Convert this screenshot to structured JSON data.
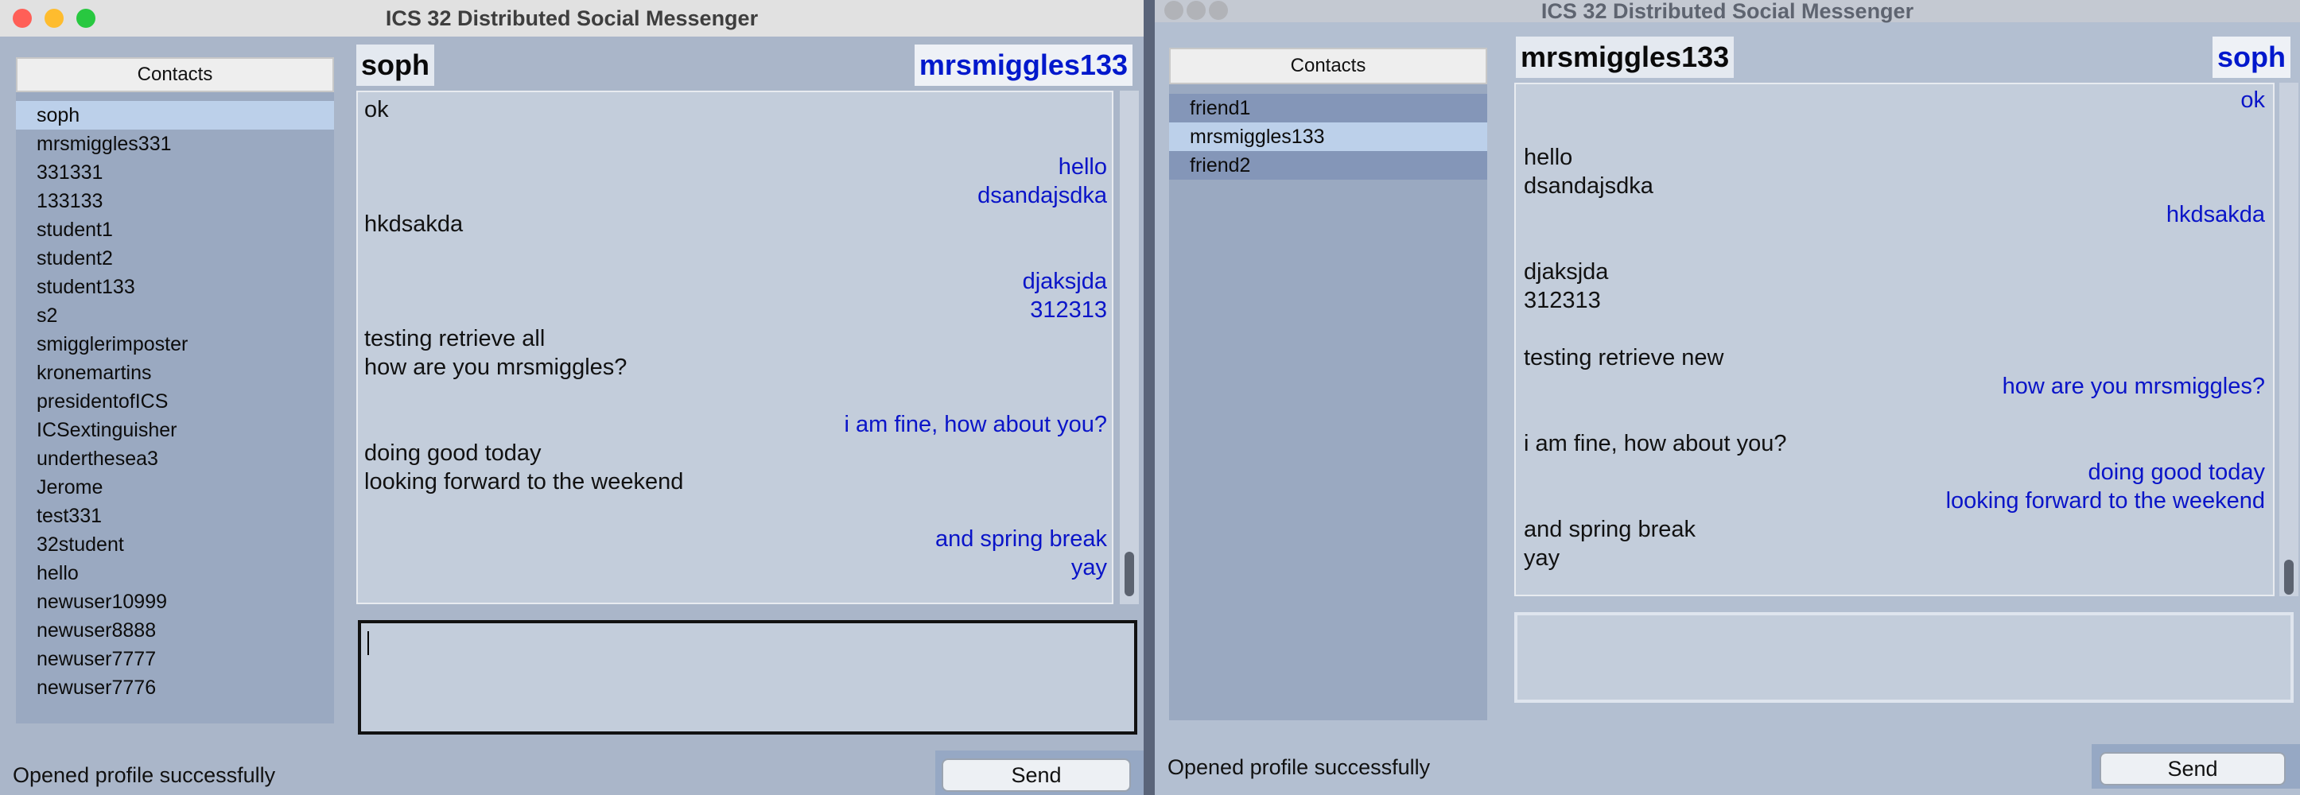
{
  "left_window": {
    "title": "ICS 32 Distributed Social Messenger",
    "contacts_header": "Contacts",
    "contacts": [
      {
        "name": "soph",
        "selected": true
      },
      {
        "name": "mrsmiggles331",
        "selected": false
      },
      {
        "name": "331331",
        "selected": false
      },
      {
        "name": "133133",
        "selected": false
      },
      {
        "name": "student1",
        "selected": false
      },
      {
        "name": "student2",
        "selected": false
      },
      {
        "name": "student133",
        "selected": false
      },
      {
        "name": "s2",
        "selected": false
      },
      {
        "name": "smigglerimposter",
        "selected": false
      },
      {
        "name": "kronemartins",
        "selected": false
      },
      {
        "name": "presidentofICS",
        "selected": false
      },
      {
        "name": "ICSextinguisher",
        "selected": false
      },
      {
        "name": "underthesea3",
        "selected": false
      },
      {
        "name": "Jerome",
        "selected": false
      },
      {
        "name": "test331",
        "selected": false
      },
      {
        "name": "32student",
        "selected": false
      },
      {
        "name": "hello",
        "selected": false
      },
      {
        "name": "newuser10999",
        "selected": false
      },
      {
        "name": "newuser8888",
        "selected": false
      },
      {
        "name": "newuser7777",
        "selected": false
      },
      {
        "name": "newuser7776",
        "selected": false
      }
    ],
    "recipient": "soph",
    "current_user": "mrsmiggles133",
    "messages": [
      {
        "text": "ok",
        "from": "mine"
      },
      {
        "text": "",
        "from": "blank"
      },
      {
        "text": "hello",
        "from": "theirs"
      },
      {
        "text": "dsandajsdka",
        "from": "theirs"
      },
      {
        "text": "hkdsakda",
        "from": "mine"
      },
      {
        "text": "",
        "from": "blank"
      },
      {
        "text": "djaksjda",
        "from": "theirs"
      },
      {
        "text": "312313",
        "from": "theirs"
      },
      {
        "text": "testing retrieve all",
        "from": "mine"
      },
      {
        "text": "how are you mrsmiggles?",
        "from": "mine"
      },
      {
        "text": "",
        "from": "blank"
      },
      {
        "text": "i am fine, how about you?",
        "from": "theirs"
      },
      {
        "text": "doing good today",
        "from": "mine"
      },
      {
        "text": "looking forward to the weekend",
        "from": "mine"
      },
      {
        "text": "",
        "from": "blank"
      },
      {
        "text": "and spring break",
        "from": "theirs"
      },
      {
        "text": "yay",
        "from": "theirs"
      }
    ],
    "status": "Opened profile successfully",
    "send_label": "Send"
  },
  "right_window": {
    "title": "ICS 32 Distributed Social Messenger",
    "contacts_header": "Contacts",
    "contacts": [
      {
        "name": "friend1",
        "selected": false
      },
      {
        "name": "mrsmiggles133",
        "selected": true
      },
      {
        "name": "friend2",
        "selected": false
      }
    ],
    "recipient": "mrsmiggles133",
    "current_user": "soph",
    "messages": [
      {
        "text": "ok",
        "from": "theirs"
      },
      {
        "text": "",
        "from": "blank"
      },
      {
        "text": "hello",
        "from": "mine"
      },
      {
        "text": "dsandajsdka",
        "from": "mine"
      },
      {
        "text": "hkdsakda",
        "from": "theirs"
      },
      {
        "text": "",
        "from": "blank"
      },
      {
        "text": "djaksjda",
        "from": "mine"
      },
      {
        "text": "312313",
        "from": "mine"
      },
      {
        "text": "",
        "from": "blank"
      },
      {
        "text": "testing retrieve new",
        "from": "mine"
      },
      {
        "text": "how are you mrsmiggles?",
        "from": "theirs"
      },
      {
        "text": "",
        "from": "blank"
      },
      {
        "text": "i am fine, how about you?",
        "from": "mine"
      },
      {
        "text": "doing good today",
        "from": "theirs"
      },
      {
        "text": "looking forward to the weekend",
        "from": "theirs"
      },
      {
        "text": "and spring break",
        "from": "mine"
      },
      {
        "text": "yay",
        "from": "mine"
      }
    ],
    "status": "Opened profile successfully",
    "send_label": "Send"
  },
  "colors": {
    "close": "#ff5f57",
    "minimize": "#febc2e",
    "zoom": "#28c840",
    "their_message": "#0a14c8",
    "selected_contact": "#bcd0ea"
  }
}
